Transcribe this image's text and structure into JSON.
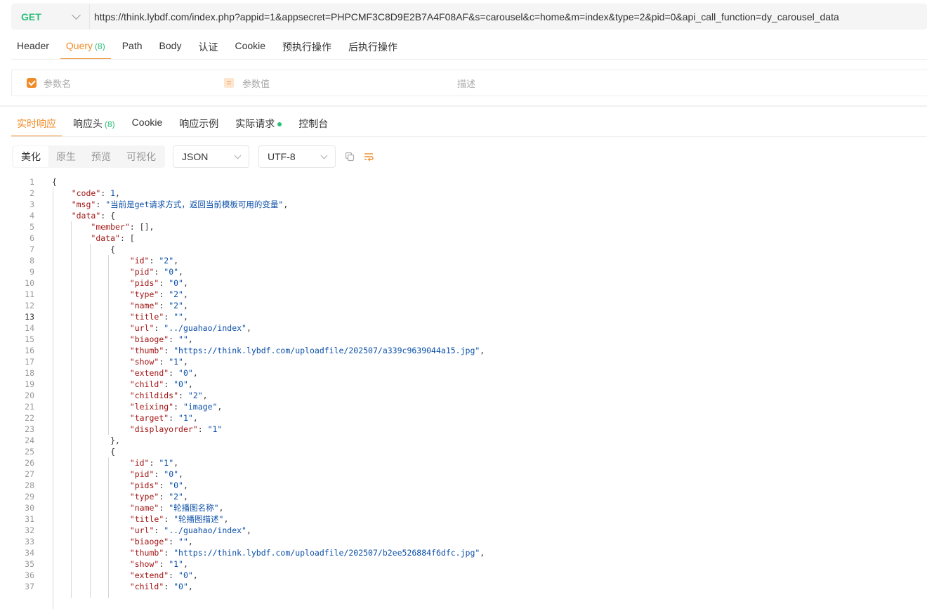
{
  "request": {
    "method": "GET",
    "url": "https://think.lybdf.com/index.php?appid=1&appsecret=PHPCMF3C8D9E2B7A4F08AF&s=carousel&c=home&m=index&type=2&pid=0&api_call_function=dy_carousel_data"
  },
  "req_tabs": [
    {
      "label": "Header",
      "badge": ""
    },
    {
      "label": "Query",
      "badge": "(8)"
    },
    {
      "label": "Path",
      "badge": ""
    },
    {
      "label": "Body",
      "badge": ""
    },
    {
      "label": "认证",
      "badge": ""
    },
    {
      "label": "Cookie",
      "badge": ""
    },
    {
      "label": "预执行操作",
      "badge": ""
    },
    {
      "label": "后执行操作",
      "badge": ""
    }
  ],
  "params_header": {
    "name": "参数名",
    "eq": "=",
    "value": "参数值",
    "desc": "描述"
  },
  "resp_tabs": [
    {
      "label": "实时响应",
      "badge": ""
    },
    {
      "label": "响应头",
      "badge": "(8)"
    },
    {
      "label": "Cookie",
      "badge": ""
    },
    {
      "label": "响应示例",
      "badge": ""
    },
    {
      "label": "实际请求",
      "badge": ""
    },
    {
      "label": "控制台",
      "badge": ""
    }
  ],
  "view_modes": [
    "美化",
    "原生",
    "预览",
    "可视化"
  ],
  "format_select": "JSON",
  "encoding_select": "UTF-8",
  "colors": {
    "accent": "#f08c28",
    "method_green": "#2bbf7a",
    "json_key": "#a31515",
    "json_value": "#0b4fa8"
  },
  "icons": [
    "copy-icon",
    "wrap-icon",
    "chevron-down-icon",
    "checkbox-icon"
  ],
  "code_lines": [
    "{",
    "    \"code\": 1,",
    "    \"msg\": \"当前是get请求方式，返回当前模板可用的变量\",",
    "    \"data\": {",
    "        \"member\": [],",
    "        \"data\": [",
    "            {",
    "                \"id\": \"2\",",
    "                \"pid\": \"0\",",
    "                \"pids\": \"0\",",
    "                \"type\": \"2\",",
    "                \"name\": \"2\",",
    "                \"title\": \"\",",
    "                \"url\": \"../guahao/index\",",
    "                \"biaoge\": \"\",",
    "                \"thumb\": \"https://think.lybdf.com/uploadfile/202507/a339c9639044a15.jpg\",",
    "                \"show\": \"1\",",
    "                \"extend\": \"0\",",
    "                \"child\": \"0\",",
    "                \"childids\": \"2\",",
    "                \"leixing\": \"image\",",
    "                \"target\": \"1\",",
    "                \"displayorder\": \"1\"",
    "            },",
    "            {",
    "                \"id\": \"1\",",
    "                \"pid\": \"0\",",
    "                \"pids\": \"0\",",
    "                \"type\": \"2\",",
    "                \"name\": \"轮播图名称\",",
    "                \"title\": \"轮播图描述\",",
    "                \"url\": \"../guahao/index\",",
    "                \"biaoge\": \"\",",
    "                \"thumb\": \"https://think.lybdf.com/uploadfile/202507/b2ee526884f6dfc.jpg\",",
    "                \"show\": \"1\",",
    "                \"extend\": \"0\",",
    "                \"child\": \"0\","
  ],
  "current_line": 13
}
